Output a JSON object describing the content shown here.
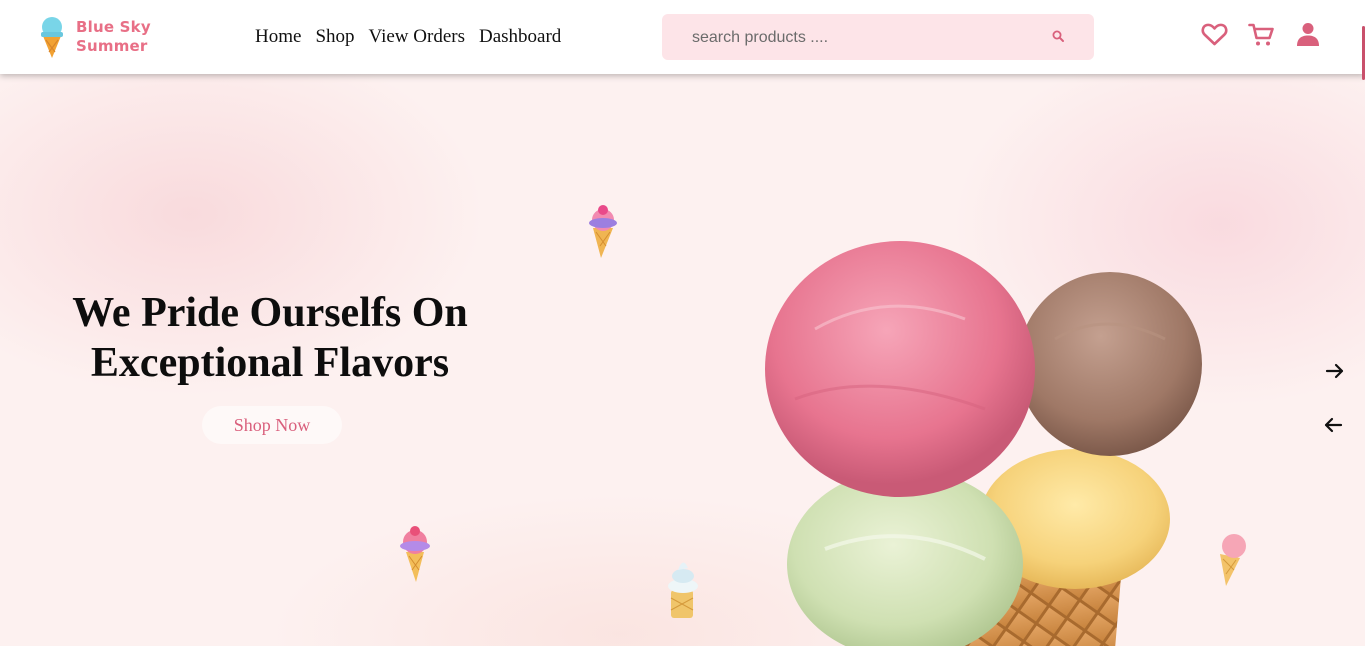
{
  "header": {
    "logo": {
      "line1": "Blue Sky",
      "line2": "Summer"
    },
    "nav": [
      {
        "label": "Home"
      },
      {
        "label": "Shop"
      },
      {
        "label": "View Orders"
      },
      {
        "label": "Dashboard"
      }
    ],
    "search": {
      "placeholder": "search products ....",
      "value": ""
    },
    "icons": [
      "heart-icon",
      "cart-icon",
      "user-icon"
    ]
  },
  "hero": {
    "title_line1": "We Pride Ourselfs On",
    "title_line2": "Exceptional Flavors",
    "cta_label": "Shop Now",
    "carousel_icons": [
      "arrow-right-icon",
      "arrow-left-icon"
    ]
  },
  "colors": {
    "brand_pink": "#e86f86",
    "logo_scoop": "#79d5e8",
    "search_bg": "#fde4e8",
    "icon_color": "#d9607c",
    "hero_bg": "#fdf1f0"
  }
}
